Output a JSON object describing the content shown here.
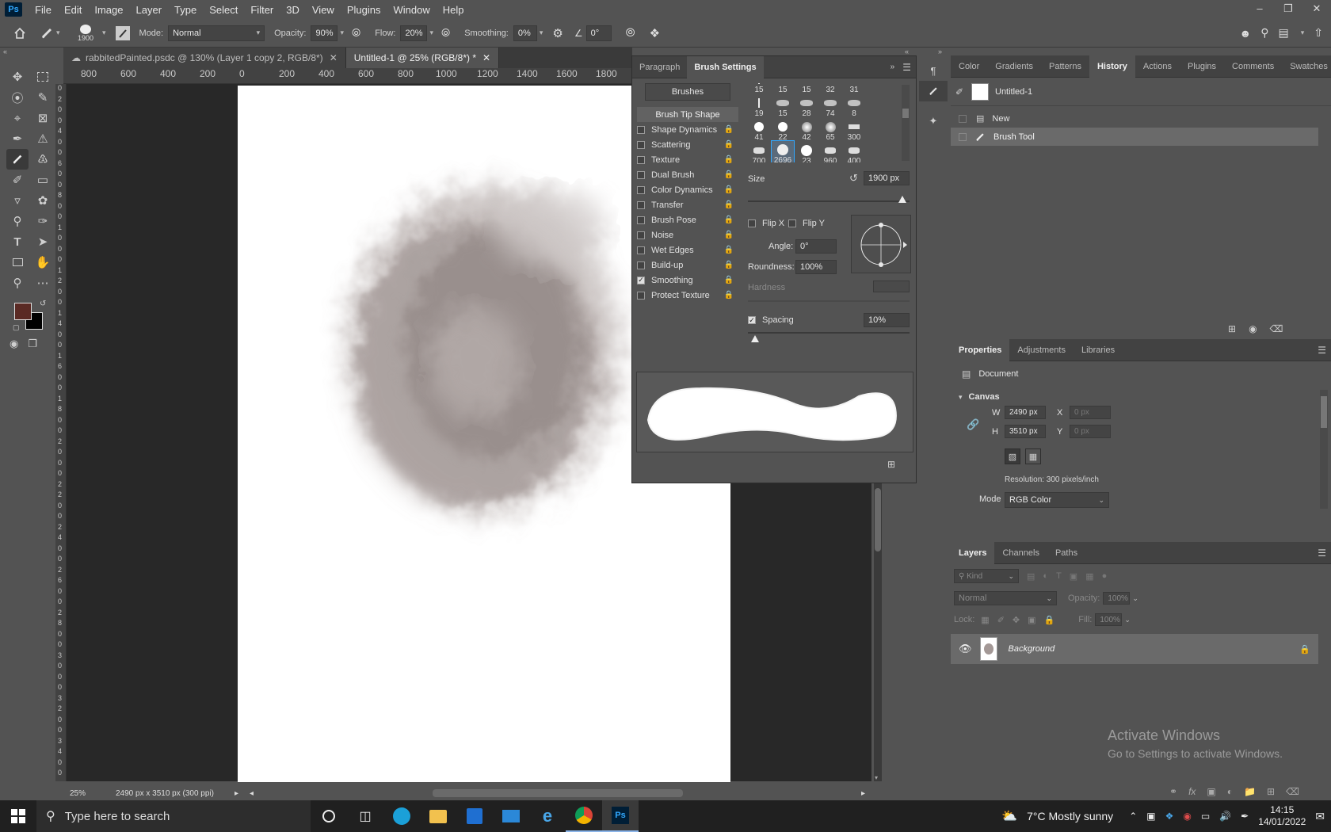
{
  "menubar": {
    "app_icon": "Ps",
    "items": [
      "File",
      "Edit",
      "Image",
      "Layer",
      "Type",
      "Select",
      "Filter",
      "3D",
      "View",
      "Plugins",
      "Window",
      "Help"
    ]
  },
  "options": {
    "brush_size": "1900",
    "mode_label": "Mode:",
    "mode_value": "Normal",
    "opacity_label": "Opacity:",
    "opacity_value": "90%",
    "flow_label": "Flow:",
    "flow_value": "20%",
    "smoothing_label": "Smoothing:",
    "smoothing_value": "0%",
    "angle_value": "0°"
  },
  "tabs": [
    {
      "label": "rabbitedPainted.psdc @ 130% (Layer 1 copy 2, RGB/8*)"
    },
    {
      "label": "Untitled-1 @ 25% (RGB/8*) *"
    }
  ],
  "ruler": {
    "h_labels": [
      "800",
      "600",
      "400",
      "200",
      "0",
      "200",
      "400",
      "600",
      "800",
      "1000",
      "1200",
      "1400",
      "1600",
      "1800"
    ],
    "v_labels": [
      "0",
      "2",
      "0",
      "0",
      "4",
      "0",
      "0",
      "6",
      "0",
      "0",
      "8",
      "0",
      "0",
      "1",
      "0",
      "0",
      "0",
      "1",
      "2",
      "0",
      "0",
      "1",
      "4",
      "0",
      "0",
      "1",
      "6",
      "0",
      "0",
      "1",
      "8",
      "0",
      "0",
      "2",
      "0",
      "0",
      "0",
      "2",
      "2",
      "0",
      "0",
      "2",
      "4",
      "0",
      "0",
      "2",
      "6",
      "0",
      "0",
      "2",
      "8",
      "0",
      "0",
      "3",
      "0",
      "0",
      "0",
      "3",
      "2",
      "0",
      "0",
      "3",
      "4",
      "0",
      "0"
    ]
  },
  "status": {
    "zoom": "25%",
    "doc_info": "2490 px x 3510 px (300 ppi)"
  },
  "brush_panel": {
    "tabs": [
      "Paragraph",
      "Brush Settings"
    ],
    "brushes_button": "Brushes",
    "tip_shape_label": "Brush Tip Shape",
    "options": [
      {
        "label": "Shape Dynamics",
        "checked": false
      },
      {
        "label": "Scattering",
        "checked": false
      },
      {
        "label": "Texture",
        "checked": false
      },
      {
        "label": "Dual Brush",
        "checked": false
      },
      {
        "label": "Color Dynamics",
        "checked": false
      },
      {
        "label": "Transfer",
        "checked": false
      },
      {
        "label": "Brush Pose",
        "checked": false
      },
      {
        "label": "Noise",
        "checked": false
      },
      {
        "label": "Wet Edges",
        "checked": false
      },
      {
        "label": "Build-up",
        "checked": false
      },
      {
        "label": "Smoothing",
        "checked": true
      },
      {
        "label": "Protect Texture",
        "checked": false
      }
    ],
    "tip_rows": [
      [
        "15",
        "15",
        "15",
        "32",
        "31"
      ],
      [
        "19",
        "15",
        "28",
        "74",
        "8"
      ],
      [
        "41",
        "22",
        "42",
        "65",
        "300"
      ],
      [
        "700",
        "2696",
        "23",
        "960",
        "400"
      ]
    ],
    "selected_tip": "2696",
    "size_label": "Size",
    "size_value": "1900 px",
    "flip_x": "Flip X",
    "flip_y": "Flip Y",
    "angle_label": "Angle:",
    "angle_value": "0°",
    "roundness_label": "Roundness:",
    "roundness_value": "100%",
    "hardness_label": "Hardness",
    "spacing_label": "Spacing",
    "spacing_value": "10%"
  },
  "history_panel": {
    "tabs": [
      "Color",
      "Gradients",
      "Patterns",
      "History",
      "Actions",
      "Plugins",
      "Comments",
      "Swatches"
    ],
    "active_tab": "History",
    "snapshot": "Untitled-1",
    "items": [
      "New",
      "Brush Tool"
    ]
  },
  "properties_panel": {
    "tabs": [
      "Properties",
      "Adjustments",
      "Libraries"
    ],
    "doc_label": "Document",
    "canvas_label": "Canvas",
    "w_label": "W",
    "w_value": "2490 px",
    "h_label": "H",
    "h_value": "3510 px",
    "x_label": "X",
    "x_placeholder": "0 px",
    "y_label": "Y",
    "y_placeholder": "0 px",
    "resolution": "Resolution: 300 pixels/inch",
    "mode_label": "Mode",
    "mode_value": "RGB Color"
  },
  "layers_panel": {
    "tabs": [
      "Layers",
      "Channels",
      "Paths"
    ],
    "kind_placeholder": "Kind",
    "blend": "Normal",
    "opacity_label": "Opacity:",
    "opacity_value": "100%",
    "lock_label": "Lock:",
    "fill_label": "Fill:",
    "fill_value": "100%",
    "layer_name": "Background"
  },
  "watermark": {
    "line1": "Activate Windows",
    "line2": "Go to Settings to activate Windows."
  },
  "taskbar": {
    "search_placeholder": "Type here to search",
    "weather": "7°C  Mostly sunny",
    "time": "14:15",
    "date": "14/01/2022"
  },
  "colors": {
    "foreground": "#5a2a24",
    "background": "#000000",
    "accent": "#31a8ff",
    "smudge": "#8d8280"
  }
}
